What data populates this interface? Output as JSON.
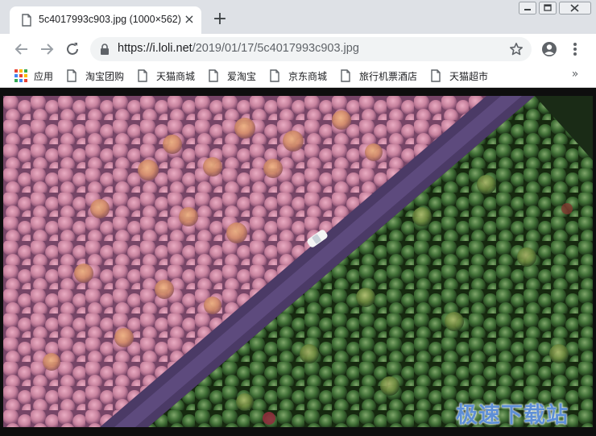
{
  "tab": {
    "title": "5c4017993c903.jpg (1000×562)",
    "close_glyph": "×"
  },
  "new_tab_glyph": "+",
  "address": {
    "host": "https://i.loli.net",
    "path": "/2019/01/17/5c4017993c903.jpg"
  },
  "bookmarks": {
    "apps_label": "应用",
    "items": [
      {
        "label": "淘宝团购"
      },
      {
        "label": "天猫商城"
      },
      {
        "label": "爱淘宝"
      },
      {
        "label": "京东商城"
      },
      {
        "label": "旅行机票酒店"
      },
      {
        "label": "天猫超市"
      }
    ],
    "overflow_glyph": "»"
  },
  "watermark": "极速下载站",
  "icons": [
    "page-icon",
    "close-icon",
    "plus-icon",
    "back-arrow-icon",
    "forward-arrow-icon",
    "reload-icon",
    "lock-icon",
    "star-icon",
    "profile-icon",
    "kebab-menu-icon",
    "apps-grid-icon",
    "bookmark-page-icon",
    "chevron-double-right-icon",
    "minimize-icon",
    "restore-icon",
    "window-close-icon"
  ],
  "colors": {
    "frame": "#dee1e6",
    "omnibox": "#f1f3f4",
    "pink_forest": "#c47a98",
    "green_forest": "#2f5a2c",
    "watermark": "#5e8fd6"
  }
}
